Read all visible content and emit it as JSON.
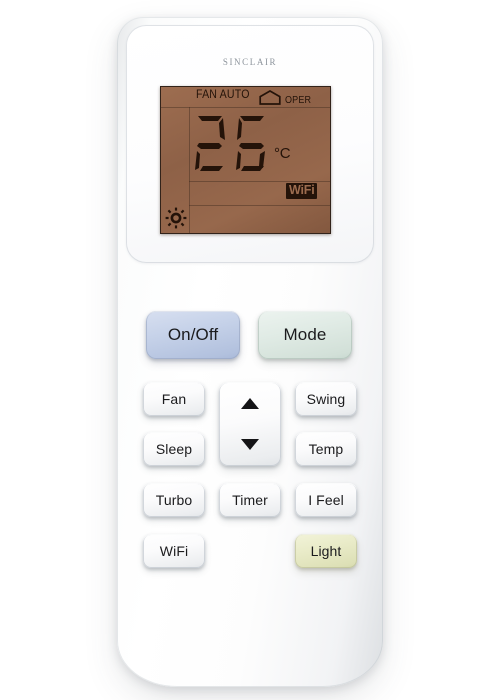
{
  "device": {
    "brand": "sinclair",
    "type": "air-conditioner-remote-control"
  },
  "display": {
    "fan_label": "FAN AUTO",
    "house_icon": "house-icon",
    "oper_label": "OPER",
    "temperature": "26",
    "unit": "°C",
    "wifi_badge": "WiFi",
    "mode_icon": "sun-icon",
    "background_color": "#8e6147",
    "segment_color": "#241309"
  },
  "buttons": {
    "on_off": "On/Off",
    "mode": "Mode",
    "fan": "Fan",
    "swing": "Swing",
    "sleep": "Sleep",
    "temp": "Temp",
    "turbo": "Turbo",
    "timer": "Timer",
    "i_feel": "I Feel",
    "wifi": "WiFi",
    "light": "Light"
  },
  "rocker": {
    "up_icon": "arrow-up-icon",
    "down_icon": "arrow-down-icon"
  },
  "colors": {
    "on_off": "#bccbe4",
    "mode": "#dce8e2",
    "light": "#e5e8c2",
    "body": "#ffffff",
    "lcd": "#8e6147"
  }
}
